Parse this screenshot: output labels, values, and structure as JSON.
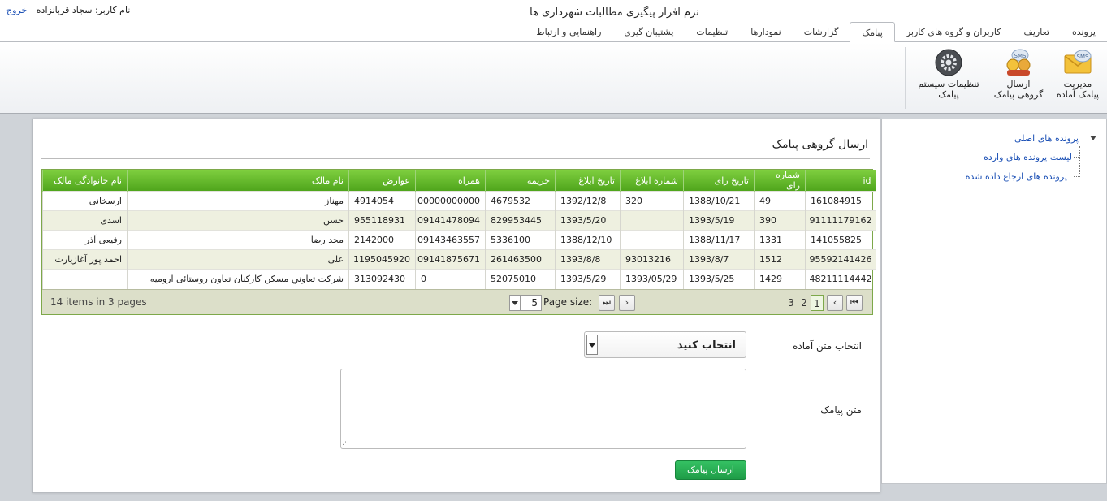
{
  "app_title": "نرم افزار پیگیری مطالبات شهرداری ها",
  "user": {
    "label": "نام کاربر: سجاد قربانزاده",
    "logout": "خروج"
  },
  "tabs": [
    {
      "label": "پرونده"
    },
    {
      "label": "تعاریف"
    },
    {
      "label": "کاربران و گروه های کاربر"
    },
    {
      "label": "پیامک",
      "active": true
    },
    {
      "label": "گزارشات"
    },
    {
      "label": "نمودارها"
    },
    {
      "label": "تنظیمات"
    },
    {
      "label": "پشتیبان گیری"
    },
    {
      "label": "راهنمایی و ارتباط"
    }
  ],
  "ribbon": {
    "prepared": {
      "line1": "مدیریت",
      "line2": "پیامک آماده",
      "icon": "envelope-sms-icon"
    },
    "group": {
      "line1": "ارسال",
      "line2": "گروهی پیامک",
      "icon": "group-sms-icon"
    },
    "settings": {
      "line1": "تنظیمات سیستم",
      "line2": "پیامک",
      "icon": "gear-settings-icon"
    }
  },
  "sidebar": {
    "root": "پرونده های اصلی",
    "children": [
      "لیست پرونده های وارده",
      "پرونده های ارجاع داده شده"
    ]
  },
  "page_title": "ارسال گروهی پیامک",
  "grid": {
    "columns": [
      "id",
      "شماره رای",
      "تاریخ رای",
      "شماره ابلاغ",
      "تاریخ ابلاغ",
      "جریمه",
      "همراه",
      "عوارض",
      "نام مالک",
      "نام خانوادگی مالک"
    ],
    "rows": [
      [
        "161084915",
        "49",
        "1388/10/21",
        "320",
        "1392/12/8",
        "4679532",
        "00000000000",
        "4914054",
        "مهناز",
        "ارسخانی"
      ],
      [
        "91111179162",
        "390",
        "1393/5/19",
        "",
        "1393/5/20",
        "829953445",
        "09141478094",
        "955118931",
        "حسن",
        "اسدی"
      ],
      [
        "141055825",
        "1331",
        "1388/11/17",
        "",
        "1388/12/10",
        "5336100",
        "09143463557",
        "2142000",
        "محد رضا",
        "رفیعی آذر"
      ],
      [
        "95592141426",
        "1512",
        "1393/8/7",
        "93013216",
        "1393/8/8",
        "261463500",
        "09141875671",
        "1195045920",
        "علی",
        "احمد پور آغازیارت"
      ],
      [
        "48211114442",
        "1429",
        "1393/5/25",
        "1393/05/29",
        "1393/5/29",
        "52075010",
        "0",
        "313092430",
        "شرکت تعاوني مسکن کارکنان تعاون روستائی ارومیه",
        ""
      ]
    ],
    "pager": {
      "pages": [
        "1",
        "2",
        "3"
      ],
      "current": "1",
      "page_size_label": "Page size:",
      "page_size": "5",
      "items_info": "14 items in 3 pages"
    }
  },
  "form": {
    "select_label": "انتخاب متن آماده",
    "select_value": "انتخاب کنید",
    "text_label": "متن پیامک",
    "text_value": "",
    "send_label": "ارسال پیامک"
  },
  "colors": {
    "grid_header": "#5cb52a",
    "send_button": "#28a852",
    "link": "#1a4fb5"
  }
}
